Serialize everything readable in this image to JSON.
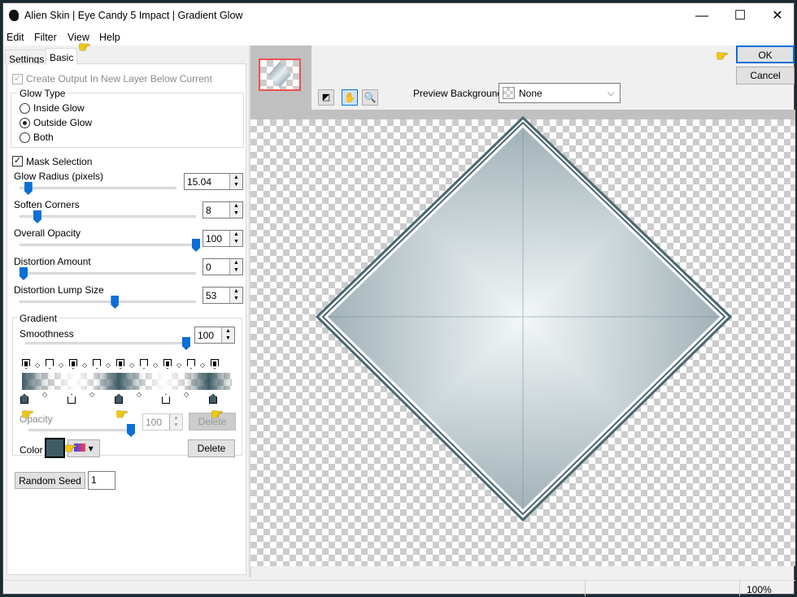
{
  "window": {
    "title": "Alien Skin | Eye Candy 5 Impact | Gradient Glow",
    "minimize": "—",
    "maximize": "☐",
    "close": "✕"
  },
  "menu": [
    "Edit",
    "Filter",
    "View",
    "Help"
  ],
  "tabs": [
    "Settings",
    "Basic"
  ],
  "basic": {
    "create_output": "Create Output In New Layer Below Current",
    "glow_type_label": "Glow Type",
    "glow_types": [
      "Inside Glow",
      "Outside Glow",
      "Both"
    ],
    "glow_type_selected": "Outside Glow",
    "mask_selection": "Mask Selection",
    "sliders": [
      {
        "label": "Glow Radius (pixels)",
        "value": "15.04",
        "fraction": 0.03
      },
      {
        "label": "Soften Corners",
        "value": "8",
        "fraction": 0.08
      },
      {
        "label": "Overall Opacity",
        "value": "100",
        "fraction": 1.0
      },
      {
        "label": "Distortion Amount",
        "value": "0",
        "fraction": 0.0
      },
      {
        "label": "Distortion Lump Size",
        "value": "53",
        "fraction": 0.53
      }
    ],
    "gradient": {
      "label": "Gradient",
      "smoothness_label": "Smoothness",
      "smoothness": "100",
      "smoothness_fraction": 1.0,
      "opacity_label": "Opacity",
      "opacity": "100",
      "delete_label": "Delete",
      "color_label": "Color",
      "color": "#3e5c66",
      "color_delete_label": "Delete"
    },
    "random_seed_label": "Random Seed",
    "random_seed": "1"
  },
  "buttons": {
    "ok": "OK",
    "cancel": "Cancel"
  },
  "preview": {
    "background_label": "Preview Background:",
    "background_value": "None",
    "zoom": "100%"
  },
  "colors": {
    "accent": "#0a6fd6",
    "glow": "#3e5c66"
  }
}
